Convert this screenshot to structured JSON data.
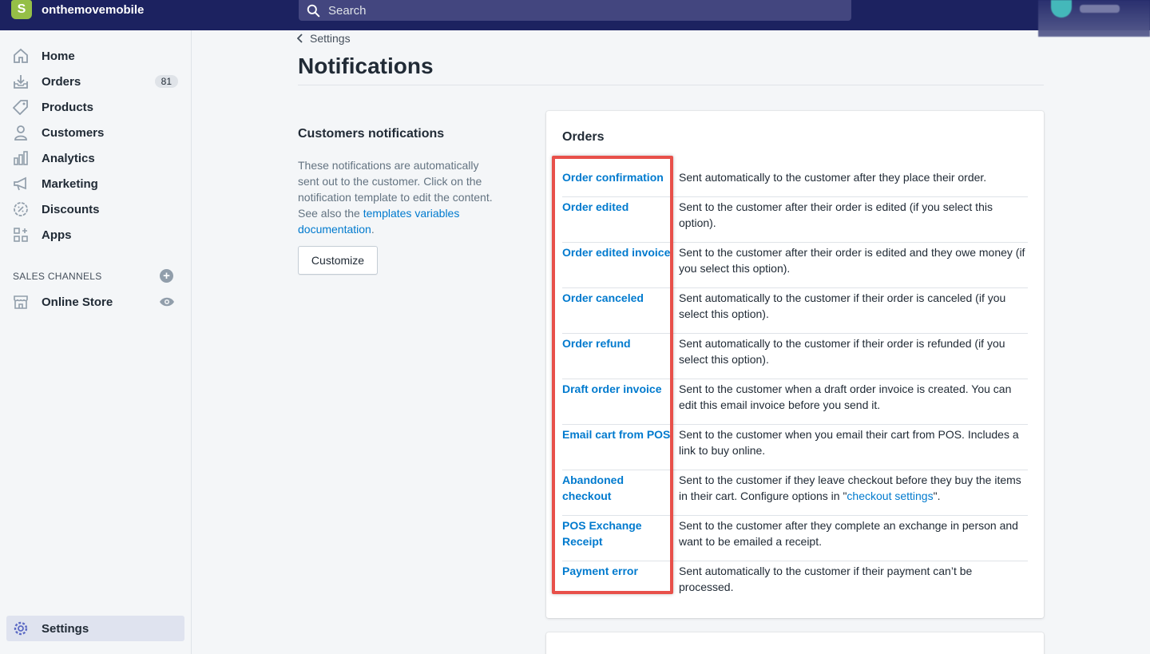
{
  "topbar": {
    "store_name": "onthemovemobile",
    "logo_letter": "S",
    "search_placeholder": "Search"
  },
  "sidebar": {
    "items": [
      {
        "label": "Home",
        "icon": "home-icon"
      },
      {
        "label": "Orders",
        "icon": "orders-icon",
        "badge": "81"
      },
      {
        "label": "Products",
        "icon": "tag-icon"
      },
      {
        "label": "Customers",
        "icon": "person-icon"
      },
      {
        "label": "Analytics",
        "icon": "bar-chart-icon"
      },
      {
        "label": "Marketing",
        "icon": "megaphone-icon"
      },
      {
        "label": "Discounts",
        "icon": "discount-icon"
      },
      {
        "label": "Apps",
        "icon": "apps-icon"
      }
    ],
    "sales_channels_title": "SALES CHANNELS",
    "online_store": "Online Store",
    "settings": "Settings"
  },
  "main": {
    "breadcrumb": "Settings",
    "title": "Notifications",
    "section": {
      "title": "Customers notifications",
      "desc_text": "These notifications are automatically sent out to the customer. Click on the notification template to edit the content. See also the ",
      "desc_link": "templates variables documentation",
      "desc_end": ".",
      "button": "Customize"
    },
    "card": {
      "title": "Orders",
      "rows": [
        {
          "name": "Order confirmation",
          "desc": "Sent automatically to the customer after they place their order."
        },
        {
          "name": "Order edited",
          "desc": "Sent to the customer after their order is edited (if you select this option)."
        },
        {
          "name": "Order edited invoice",
          "desc": "Sent to the customer after their order is edited and they owe money (if you select this option)."
        },
        {
          "name": "Order canceled",
          "desc": "Sent automatically to the customer if their order is canceled (if you select this option)."
        },
        {
          "name": "Order refund",
          "desc": "Sent automatically to the customer if their order is refunded (if you select this option)."
        },
        {
          "name": "Draft order invoice",
          "desc": "Sent to the customer when a draft order invoice is created. You can edit this email invoice before you send it."
        },
        {
          "name": "Email cart from POS",
          "desc": "Sent to the customer when you email their cart from POS. Includes a link to buy online."
        },
        {
          "name": "Abandoned checkout",
          "desc_before": "Sent to the customer if they leave checkout before they buy the items in their cart. Configure options in \"",
          "desc_link": "checkout settings",
          "desc_after": "\"."
        },
        {
          "name": "POS Exchange Receipt",
          "desc": "Sent to the customer after they complete an exchange in person and want to be emailed a receipt."
        },
        {
          "name": "Payment error",
          "desc": "Sent automatically to the customer if their payment can’t be processed."
        }
      ]
    }
  },
  "colors": {
    "topbar": "#1c2260",
    "link": "#007ace",
    "highlight": "#e8504a",
    "logo": "#95bf47"
  }
}
